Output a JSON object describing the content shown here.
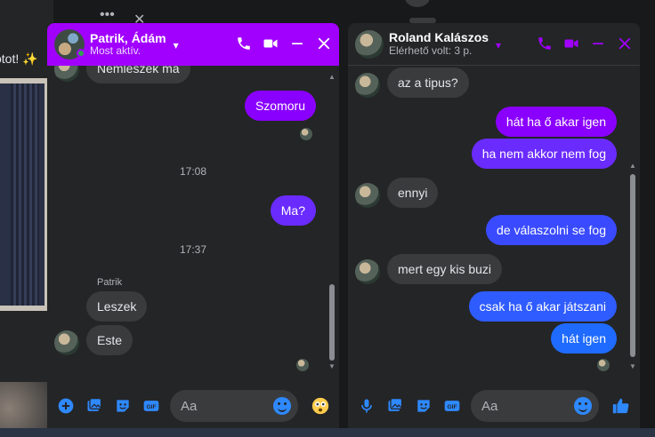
{
  "background": {
    "partial_text": "otot! ✨"
  },
  "chat1": {
    "name": "Patrik, Ádám",
    "status": "Most aktív.",
    "messages": {
      "m1": "Nemleszek ma",
      "m2": "Szomoru",
      "t1": "17:08",
      "m3": "Ma?",
      "t2": "17:37",
      "sender": "Patrik",
      "m4": "Leszek",
      "m5": "Este"
    },
    "input_placeholder": "Aa"
  },
  "chat2": {
    "name": "Roland Kalászos",
    "status": "Elérhető volt: 3 p.",
    "messages": {
      "m1": "az a tipus?",
      "m2": "hát ha ő akar igen",
      "m3": "ha nem akkor nem fog",
      "m4": "ennyi",
      "m5": "de válaszolni se fog",
      "m6": "mert egy kis buzi",
      "m7": "csak ha ő akar játszani",
      "m8": "hát igen"
    },
    "input_placeholder": "Aa"
  },
  "icons": {
    "call": "phone-icon",
    "video": "video-icon",
    "minimize": "minimize-icon",
    "close": "close-icon",
    "add": "plus-circle-icon",
    "image": "image-icon",
    "sticker": "sticker-icon",
    "gif": "gif-icon",
    "mic": "microphone-icon",
    "emoji": "emoji-icon",
    "like": "thumbs-up-icon"
  },
  "colors": {
    "accent_purple": "#a100ff",
    "accent_blue": "#2e89ff",
    "panel": "#242526",
    "bubble_in": "#3a3b3c"
  }
}
